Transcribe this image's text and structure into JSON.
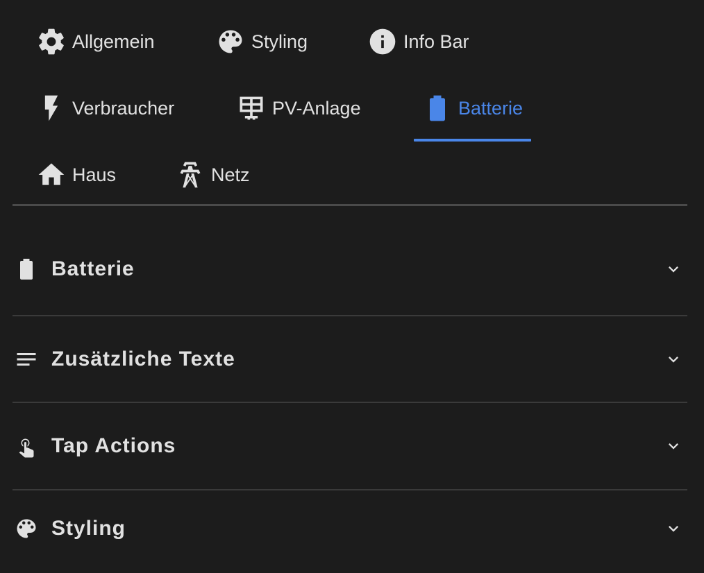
{
  "tabs": [
    {
      "label": "Allgemein",
      "icon": "gear-icon"
    },
    {
      "label": "Styling",
      "icon": "palette-icon"
    },
    {
      "label": "Info Bar",
      "icon": "info-icon"
    },
    {
      "label": "Verbraucher",
      "icon": "lightning-icon"
    },
    {
      "label": "PV-Anlage",
      "icon": "solar-panel-icon"
    },
    {
      "label": "Batterie",
      "icon": "battery-icon",
      "active": true
    },
    {
      "label": "Haus",
      "icon": "home-icon"
    },
    {
      "label": "Netz",
      "icon": "transmission-tower-icon"
    }
  ],
  "panels": [
    {
      "title": "Batterie",
      "icon": "battery-icon"
    },
    {
      "title": "Zusätzliche Texte",
      "icon": "text-lines-icon"
    },
    {
      "title": "Tap Actions",
      "icon": "gesture-tap-icon"
    },
    {
      "title": "Styling",
      "icon": "palette-icon"
    }
  ],
  "colors": {
    "background": "#1c1c1c",
    "text": "#e1e1e1",
    "accent": "#4a86e8",
    "divider": "#3a3a3a"
  }
}
